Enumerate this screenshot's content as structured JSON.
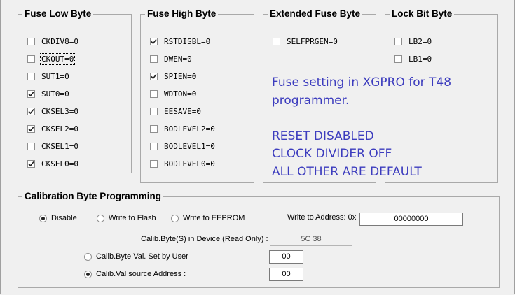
{
  "fuse_low_byte": {
    "title": "Fuse Low Byte",
    "items": [
      {
        "label": "CKDIV8=0",
        "checked": false
      },
      {
        "label": "CKOUT=0",
        "checked": false
      },
      {
        "label": "SUT1=0",
        "checked": false
      },
      {
        "label": "SUT0=0",
        "checked": true
      },
      {
        "label": "CKSEL3=0",
        "checked": true
      },
      {
        "label": "CKSEL2=0",
        "checked": true
      },
      {
        "label": "CKSEL1=0",
        "checked": false
      },
      {
        "label": "CKSEL0=0",
        "checked": true
      }
    ]
  },
  "fuse_high_byte": {
    "title": "Fuse High Byte",
    "items": [
      {
        "label": "RSTDISBL=0",
        "checked": true
      },
      {
        "label": "DWEN=0",
        "checked": false
      },
      {
        "label": "SPIEN=0",
        "checked": true
      },
      {
        "label": "WDTON=0",
        "checked": false
      },
      {
        "label": "EESAVE=0",
        "checked": false
      },
      {
        "label": "BODLEVEL2=0",
        "checked": false
      },
      {
        "label": "BODLEVEL1=0",
        "checked": false
      },
      {
        "label": "BODLEVEL0=0",
        "checked": false
      }
    ]
  },
  "extended_fuse_byte": {
    "title": "Extended Fuse Byte",
    "items": [
      {
        "label": "SELFPRGEN=0",
        "checked": false
      }
    ]
  },
  "lock_bit_byte": {
    "title": "Lock Bit Byte",
    "items": [
      {
        "label": "LB2=0",
        "checked": false
      },
      {
        "label": "LB1=0",
        "checked": false
      }
    ]
  },
  "annotation": {
    "lines": [
      "Fuse setting in XGPRO for T48",
      "programmer.",
      "",
      "RESET DISABLED",
      "CLOCK DIVIDER OFF",
      "ALL OTHER ARE DEFAULT"
    ],
    "color": "#3c3cbe"
  },
  "calibration": {
    "title": "Calibration Byte Programming",
    "mode_options": [
      {
        "label": "Disable",
        "selected": true
      },
      {
        "label": "Write to Flash",
        "selected": false
      },
      {
        "label": "Write to EEPROM",
        "selected": false
      }
    ],
    "write_address_label": "Write to Address: 0x",
    "write_address_value": "00000000",
    "calib_device_label": "Calib.Byte(S) in Device (Read Only) :",
    "calib_device_value": "5C 38",
    "source_options": [
      {
        "label": "Calib.Byte Val. Set by User",
        "selected": false,
        "value": "00"
      },
      {
        "label": "Calib.Val source Address :",
        "selected": true,
        "value": "00"
      }
    ]
  }
}
